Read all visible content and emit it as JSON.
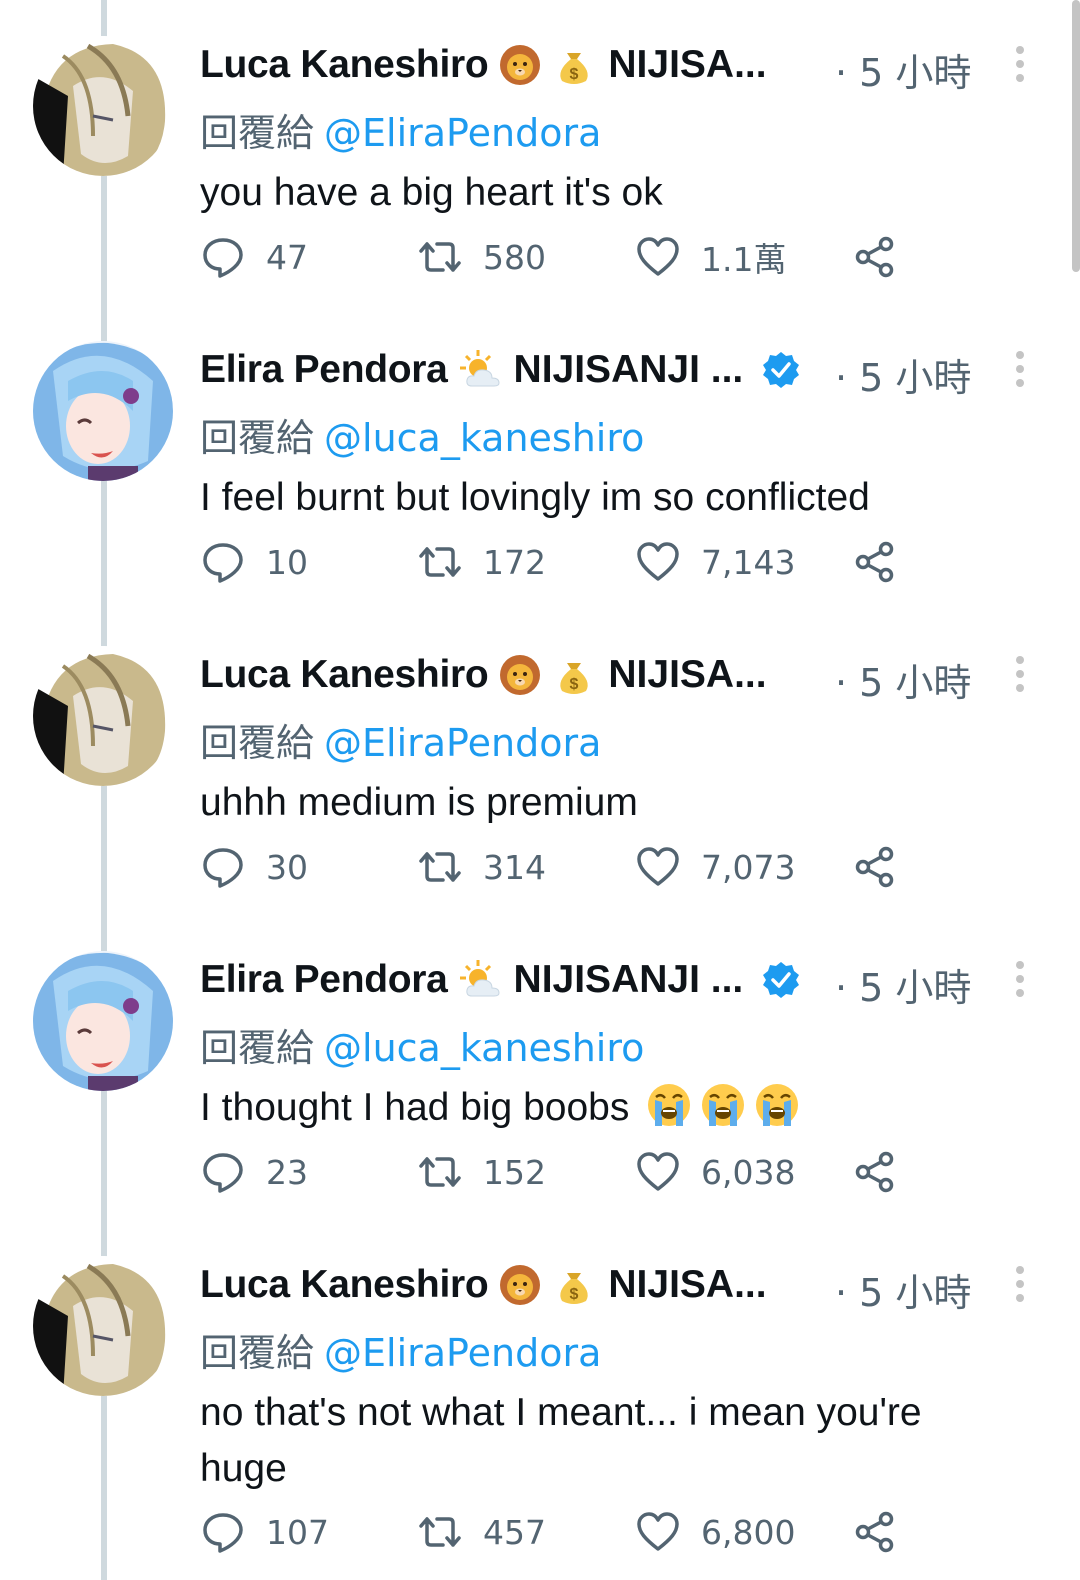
{
  "colors": {
    "accent": "#1d9bf0",
    "secondary_text": "#536471",
    "thread_line": "#cfd9de"
  },
  "tweets": [
    {
      "name": "Luca Kaneshiro",
      "org": "NIJISA...",
      "emojis": [
        "lion-emoji",
        "money-bag-emoji"
      ],
      "verified": false,
      "time": "· 5 小時",
      "reply_prefix": "回覆給",
      "reply_to": "@EliraPendora",
      "text": "you have a big heart it's ok",
      "replies": "47",
      "retweets": "580",
      "likes": "1.1萬"
    },
    {
      "name": "Elira Pendora",
      "org": "NIJISANJI ...",
      "emojis": [
        "sun-behind-cloud-emoji"
      ],
      "verified": true,
      "time": "· 5 小時",
      "reply_prefix": "回覆給",
      "reply_to": "@luca_kaneshiro",
      "text": "I feel burnt but lovingly im so conflicted",
      "replies": "10",
      "retweets": "172",
      "likes": "7,143"
    },
    {
      "name": "Luca Kaneshiro",
      "org": "NIJISA...",
      "emojis": [
        "lion-emoji",
        "money-bag-emoji"
      ],
      "verified": false,
      "time": "· 5 小時",
      "reply_prefix": "回覆給",
      "reply_to": "@EliraPendora",
      "text": "uhhh medium is premium",
      "replies": "30",
      "retweets": "314",
      "likes": "7,073"
    },
    {
      "name": "Elira Pendora",
      "org": "NIJISANJI ...",
      "emojis": [
        "sun-behind-cloud-emoji"
      ],
      "verified": true,
      "time": "· 5 小時",
      "reply_prefix": "回覆給",
      "reply_to": "@luca_kaneshiro",
      "text": "I thought I had big boobs",
      "text_emojis": [
        "loudly-crying-emoji",
        "loudly-crying-emoji",
        "loudly-crying-emoji"
      ],
      "replies": "23",
      "retweets": "152",
      "likes": "6,038"
    },
    {
      "name": "Luca Kaneshiro",
      "org": "NIJISA...",
      "emojis": [
        "lion-emoji",
        "money-bag-emoji"
      ],
      "verified": false,
      "time": "· 5 小時",
      "reply_prefix": "回覆給",
      "reply_to": "@EliraPendora",
      "text": "no that's not what I meant...  i mean you're huge",
      "replies": "107",
      "retweets": "457",
      "likes": "6,800"
    }
  ]
}
